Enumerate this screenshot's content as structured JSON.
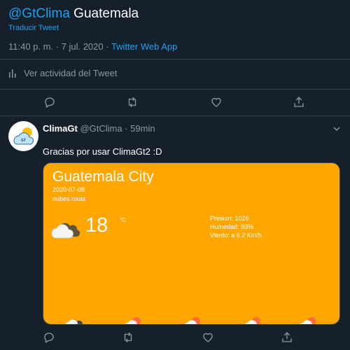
{
  "tweet": {
    "mention": "@GtClima",
    "text": " Guatemala",
    "translate": "Traducir Tweet",
    "time": "11:40 p. m. · 7 jul. 2020 · ",
    "app": "Twitter Web App",
    "activity": "Ver actividad del Tweet"
  },
  "reply": {
    "name": "ClimaGt",
    "handle": "@GtClima · 59min",
    "text": "Gracias por usar ClimaGt2 :D",
    "avatar_text": "GT"
  },
  "weather": {
    "city": "Guatemala City",
    "date": "2020-07-08",
    "condition": "nubes rotas",
    "temperature": "18",
    "unit": "°C",
    "pressure": "Presion: 1026",
    "humidity": "Humedad: 93%",
    "wind": "Viento: a 6.2 Km/h",
    "forecast_icons": [
      "cloud-icon",
      "cloud-sun-icon",
      "cloud-sun-icon",
      "cloud-sun-icon",
      "cloud-sun-icon"
    ]
  },
  "colors": {
    "background": "#15202b",
    "accent": "#1da1f2",
    "card": "#ffa600",
    "muted": "#8899a6"
  }
}
